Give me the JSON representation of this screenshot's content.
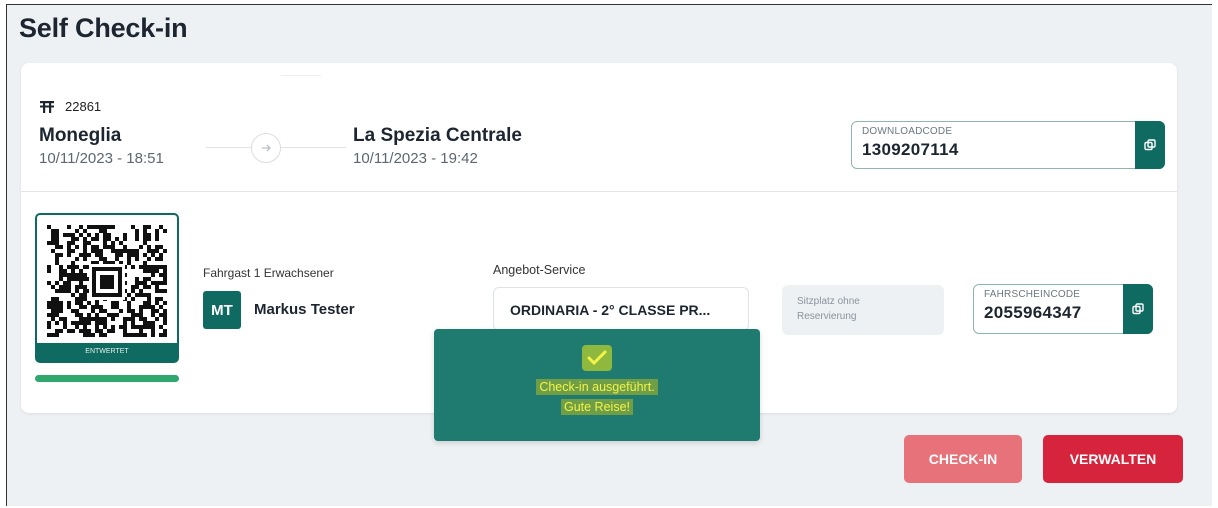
{
  "page": {
    "title": "Self Check-in"
  },
  "trip": {
    "train_number": "22861",
    "origin": {
      "name": "Moneglia",
      "datetime": "10/11/2023 - 18:51"
    },
    "destination": {
      "name": "La Spezia Centrale",
      "datetime": "10/11/2023 - 19:42"
    },
    "download_code": {
      "label": "DOWNLOADCODE",
      "value": "1309207114"
    }
  },
  "ticket": {
    "qr_footer": "ENTWERTET",
    "passenger_label": "Fahrgast 1 Erwachsener",
    "avatar_initials": "MT",
    "passenger_name": "Markus Tester",
    "offer_label": "Angebot-Service",
    "offer_value": "ORDINARIA - 2° CLASSE PR...",
    "seat_text_line1": "Sitzplatz ohne",
    "seat_text_line2": "Reservierung",
    "ticket_code": {
      "label": "FAHRSCHEINCODE",
      "value": "2055964347"
    }
  },
  "toast": {
    "line1": "Check-in ausgeführt.",
    "line2": "Gute Reise!"
  },
  "buttons": {
    "checkin": "CHECK-IN",
    "manage": "VERWALTEN"
  },
  "colors": {
    "primary": "#0f6a61",
    "toast_bg": "#1f7a70",
    "checkin_btn": "#e7727a",
    "manage_btn": "#d6243c",
    "progress": "#2fa86e"
  }
}
